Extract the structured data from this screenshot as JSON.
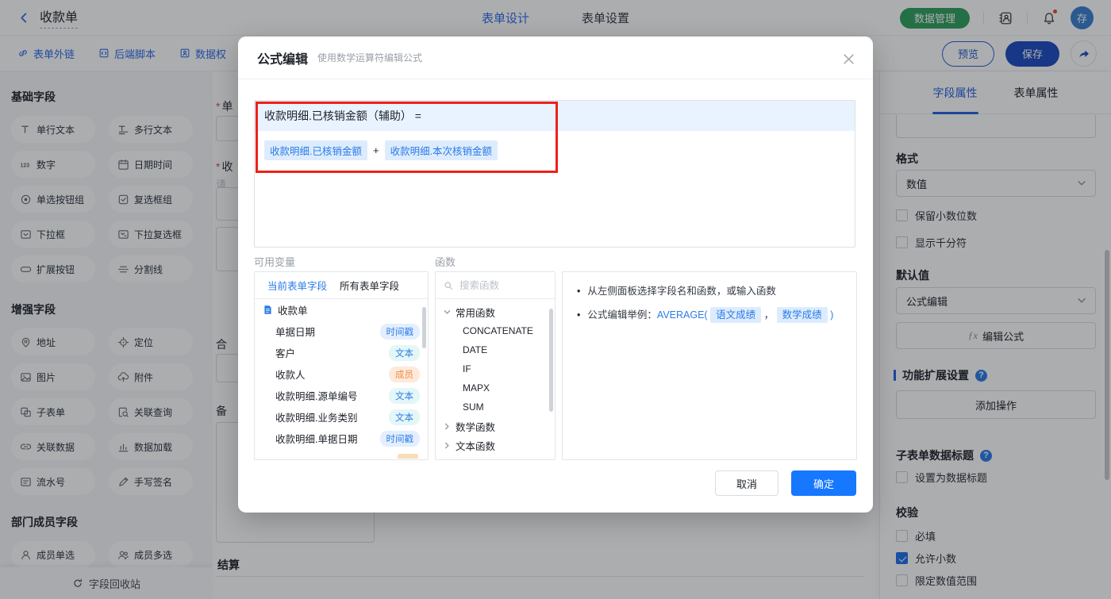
{
  "colors": {
    "accent_blue": "#2a6ae9",
    "confirm_blue": "#1677ff",
    "save_blue": "#1d4bc0",
    "manage_green": "#2fa05c",
    "annotation_red": "#ee2117",
    "badge_time": "#2f7ce8",
    "badge_member": "#f08c3f",
    "checked_blue": "#1e6fe8"
  },
  "topbar": {
    "title": "收款单",
    "tab_design": "表单设计",
    "tab_settings": "表单设置",
    "data_manage": "数据管理",
    "avatar": "存"
  },
  "toolbar": {
    "link_external": "表单外链",
    "link_script": "后端脚本",
    "link_permission": "数据权",
    "preview": "预览",
    "save": "保存"
  },
  "sidebar": {
    "section_basic": "基础字段",
    "basic_fields": [
      "单行文本",
      "多行文本",
      "数字",
      "日期时间",
      "单选按钮组",
      "复选框组",
      "下拉框",
      "下拉复选框",
      "扩展按钮",
      "分割线"
    ],
    "section_enhanced": "增强字段",
    "enhanced_fields": [
      "地址",
      "定位",
      "图片",
      "附件",
      "子表单",
      "关联查询",
      "关联数据",
      "数据加载",
      "流水号",
      "手写签名"
    ],
    "section_member": "部门成员字段",
    "member_fields": [
      "成员单选",
      "成员多选"
    ],
    "recycle": "字段回收站"
  },
  "form": {
    "asterisk": "*",
    "label_date": "单",
    "label_payee": "收",
    "placeholder": "请",
    "label_total": "合",
    "label_note": "备",
    "section_settlement": "结算"
  },
  "modal": {
    "title": "公式编辑",
    "subtitle": "使用数学运算符编辑公式",
    "formula_target": "收款明细.已核销金额（辅助） =",
    "formula_operand1": "收款明细.已核销金额",
    "formula_operator": "+",
    "formula_operand2": "收款明细.本次核销金额",
    "variables": {
      "label": "可用变量",
      "tab_current": "当前表单字段",
      "tab_all": "所有表单字段",
      "root": "收款单",
      "items": [
        {
          "name": "单据日期",
          "badge": "时间戳",
          "type": "time"
        },
        {
          "name": "客户",
          "badge": "文本",
          "type": "text"
        },
        {
          "name": "收款人",
          "badge": "成员",
          "type": "member"
        },
        {
          "name": "收款明细.源单编号",
          "badge": "文本",
          "type": "text"
        },
        {
          "name": "收款明细.业务类别",
          "badge": "文本",
          "type": "text"
        },
        {
          "name": "收款明细.单据日期",
          "badge": "时间戳",
          "type": "time"
        }
      ]
    },
    "functions": {
      "label": "函数",
      "search_placeholder": "搜索函数",
      "group_common": "常用函数",
      "common_items": [
        "CONCATENATE",
        "DATE",
        "IF",
        "MAPX",
        "SUM"
      ],
      "group_math": "数学函数",
      "group_text": "文本函数"
    },
    "tips": {
      "tip1": "从左侧面板选择字段名和函数，或输入函数",
      "tip2_prefix": "公式编辑举例：",
      "tip2_fn": "AVERAGE(",
      "tip2_chip1": "语文成绩",
      "tip2_comma": "，",
      "tip2_chip2": "数学成绩",
      "tip2_close": ")"
    },
    "cancel": "取消",
    "confirm": "确定"
  },
  "props": {
    "tab_field": "字段属性",
    "tab_form": "表单属性",
    "format_label": "格式",
    "format_value": "数值",
    "cb_decimal_digits": "保留小数位数",
    "cb_thousands": "显示千分符",
    "default_label": "默认值",
    "default_value": "公式编辑",
    "fx": "ƒx",
    "edit_formula": "编辑公式",
    "ext_label": "功能扩展设置",
    "add_action": "添加操作",
    "subform_title_label": "子表单数据标题",
    "cb_set_title": "设置为数据标题",
    "validation_label": "校验",
    "cb_required": "必填",
    "cb_allow_decimal": "允许小数",
    "cb_limit_range": "限定数值范围",
    "allow_decimal_checked": true
  }
}
